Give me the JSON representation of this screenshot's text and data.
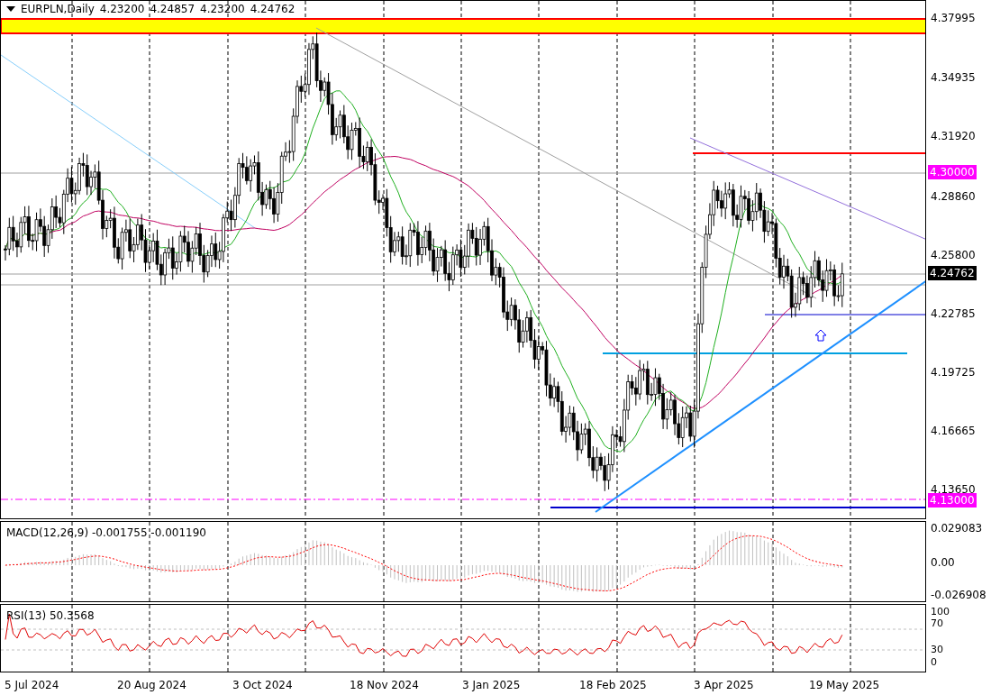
{
  "chart_header": {
    "symbol_timeframe": "EURPLN,Daily",
    "open": "4.23200",
    "high": "4.24857",
    "low": "4.23200",
    "close": "4.24762"
  },
  "price_axis": [
    {
      "kind": "tick",
      "label": "4.37995"
    },
    {
      "kind": "tick",
      "label": "4.34935"
    },
    {
      "kind": "tick",
      "label": "4.31920"
    },
    {
      "kind": "marker",
      "label": "4.30000",
      "color": "#ff00ff"
    },
    {
      "kind": "tick",
      "label": "4.28860"
    },
    {
      "kind": "tick",
      "label": "4.25800"
    },
    {
      "kind": "marker",
      "label": "4.24762",
      "color": "#000000"
    },
    {
      "kind": "tick",
      "label": "4.22785"
    },
    {
      "kind": "tick",
      "label": "4.19725"
    },
    {
      "kind": "tick",
      "label": "4.16665"
    },
    {
      "kind": "tick",
      "label": "4.13650"
    },
    {
      "kind": "marker",
      "label": "4.13000",
      "color": "#ff00ff"
    }
  ],
  "macd": {
    "title": "MACD(12,26,9) -0.001755 -0.001190",
    "axis": [
      "0.029083",
      "0.00",
      "-0.026908"
    ]
  },
  "rsi": {
    "title": "RSI(13) 50.3568",
    "axis": [
      "100",
      "70",
      "30",
      "0"
    ]
  },
  "date_axis": [
    "5 Jul 2024",
    "20 Aug 2024",
    "3 Oct 2024",
    "18 Nov 2024",
    "3 Jan 2025",
    "18 Feb 2025",
    "3 Apr 2025",
    "19 May 2025"
  ]
}
